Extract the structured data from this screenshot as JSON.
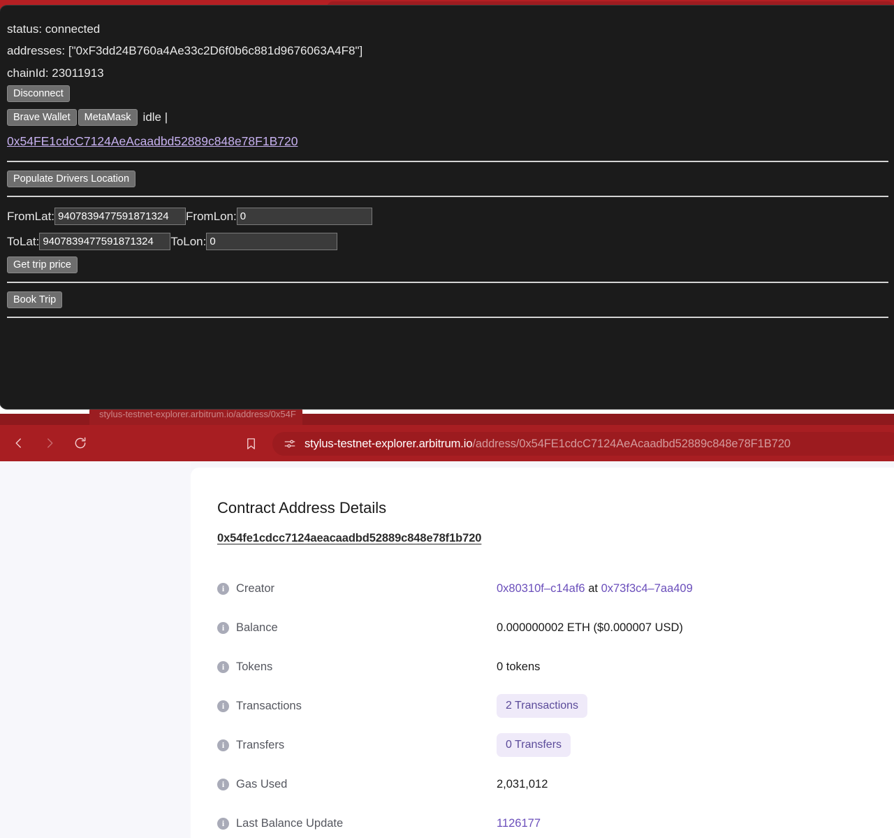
{
  "browser": {
    "background_tab_label": "stylus-testnet-explorer.arbitrum.io/address/0x54F",
    "nav": {
      "back": "back-arrow",
      "forward": "forward-arrow",
      "reload": "reload"
    },
    "bookmark_icon": "bookmark-icon",
    "site_settings_icon": "site-settings-sliders-icon",
    "url_domain": "stylus-testnet-explorer.arbitrum.io",
    "url_path": "/address/0x54FE1cdcC7124AeAcaadbd52889c848e78F1B720"
  },
  "dapp": {
    "status_line": "status: connected",
    "addresses_line": "addresses: [\"0xF3dd24B760a4Ae33c2D6f0b6c881d9676063A4F8\"]",
    "chain_line": "chainId: 23011913",
    "disconnect_label": "Disconnect",
    "connector_brave": "Brave Wallet",
    "connector_metamask": "MetaMask",
    "connect_status": "idle |",
    "contract_link": "0x54FE1cdcC7124AeAcaadbd52889c848e78F1B720",
    "populate_label": "Populate Drivers Location",
    "form": {
      "from_lat_label": "FromLat:",
      "from_lat_value": "9407839477591871324",
      "from_lon_label": "FromLon:",
      "from_lon_value": "0",
      "to_lat_label": "ToLat:",
      "to_lat_value": "9407839477591871324",
      "to_lon_label": "ToLon:",
      "to_lon_value": "0",
      "get_price_label": "Get trip price"
    },
    "book_trip_label": "Book Trip"
  },
  "explorer": {
    "title": "Contract Address Details",
    "contract_hash": "0x54fe1cdcc7124aeacaadbd52889c848e78f1b720",
    "rows": [
      {
        "label": "Creator",
        "type": "creator",
        "creator": "0x80310f–c14af6",
        "at": "at",
        "tx": "0x73f3c4–7aa409"
      },
      {
        "label": "Balance",
        "type": "text",
        "value": "0.000000002 ETH ($0.000007 USD)"
      },
      {
        "label": "Tokens",
        "type": "text",
        "value": "0 tokens"
      },
      {
        "label": "Transactions",
        "type": "badge",
        "value": "2 Transactions"
      },
      {
        "label": "Transfers",
        "type": "badge",
        "value": "0 Transfers"
      },
      {
        "label": "Gas Used",
        "type": "text",
        "value": "2,031,012"
      },
      {
        "label": "Last Balance Update",
        "type": "purple",
        "value": "1126177"
      }
    ],
    "info_icon_glyph": "i"
  },
  "colors": {
    "brand_red": "#a81e22",
    "panel_dark": "#1b1b1b",
    "link_purple": "#6b4fbb",
    "badge_bg": "#efeaf9",
    "badge_text": "#5b4b9a",
    "dapp_link": "#c6b0ef"
  }
}
